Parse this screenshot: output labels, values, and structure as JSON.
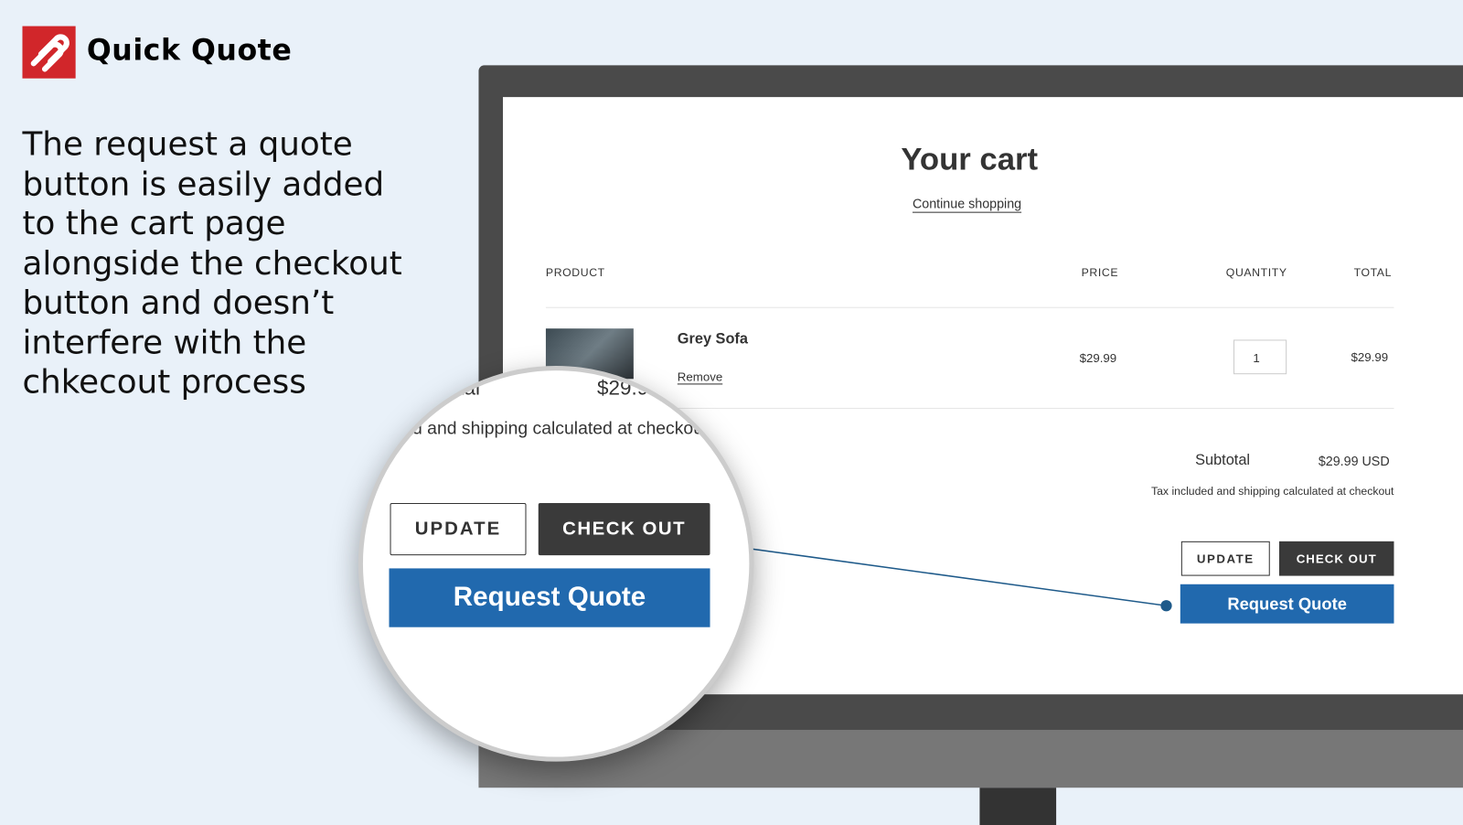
{
  "brand": {
    "name": "Quick Quote",
    "logo_color": "#d1262a"
  },
  "headline": "The request a quote button is easily added to the cart page alongside the checkout button and doesn’t interfere with the chkecout process",
  "cart": {
    "title": "Your cart",
    "continue_link": "Continue shopping",
    "columns": [
      "PRODUCT",
      "PRICE",
      "QUANTITY",
      "TOTAL"
    ],
    "items": [
      {
        "name": "Grey Sofa",
        "remove": "Remove",
        "price": "$29.99",
        "quantity": "1",
        "total": "$29.99"
      }
    ],
    "subtotal_label": "Subtotal",
    "subtotal_value": "$29.99 USD",
    "tax_note": "Tax included and shipping calculated at checkout",
    "update_label": "UPDATE",
    "checkout_label": "CHECK OUT",
    "request_quote_label": "Request Quote"
  },
  "magnifier": {
    "subtotal_fragment": "otal",
    "price_fragment": "$29.9",
    "tax_fragment": "d and shipping calculated at checkout"
  },
  "colors": {
    "accent": "#2169ae",
    "dark_button": "#3a3a3a",
    "connector": "#1e5a8a"
  }
}
